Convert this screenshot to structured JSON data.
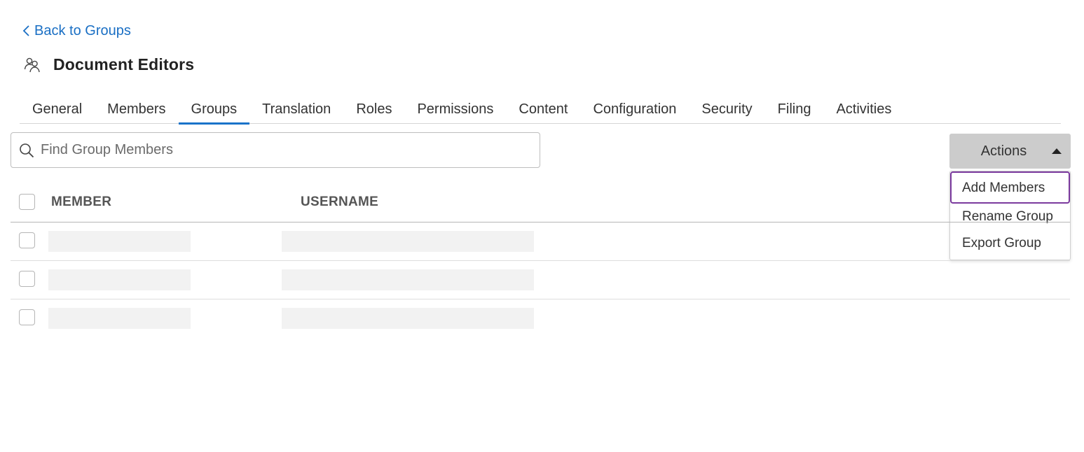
{
  "nav": {
    "back_label": "Back to Groups"
  },
  "header": {
    "title": "Document Editors",
    "icon": "group-icon"
  },
  "tabs": [
    {
      "label": "General",
      "active": false
    },
    {
      "label": "Members",
      "active": false
    },
    {
      "label": "Groups",
      "active": true
    },
    {
      "label": "Translation",
      "active": false
    },
    {
      "label": "Roles",
      "active": false
    },
    {
      "label": "Permissions",
      "active": false
    },
    {
      "label": "Content",
      "active": false
    },
    {
      "label": "Configuration",
      "active": false
    },
    {
      "label": "Security",
      "active": false
    },
    {
      "label": "Filing",
      "active": false
    },
    {
      "label": "Activities",
      "active": false
    }
  ],
  "search": {
    "placeholder": "Find Group Members",
    "value": ""
  },
  "actions": {
    "label": "Actions",
    "menu": [
      {
        "label": "Add Members",
        "focused": true
      },
      {
        "label": "Rename Group",
        "focused": false
      },
      {
        "label": "Export Group",
        "focused": false
      }
    ]
  },
  "table": {
    "columns": [
      "MEMBER",
      "USERNAME"
    ],
    "rows_loading": 3
  },
  "colors": {
    "link": "#1a6fc4",
    "tab_active_underline": "#1a73c9",
    "menu_focus_border": "#7b3a9e",
    "actions_button_bg": "#cccccc",
    "skeleton": "#f2f2f2"
  }
}
